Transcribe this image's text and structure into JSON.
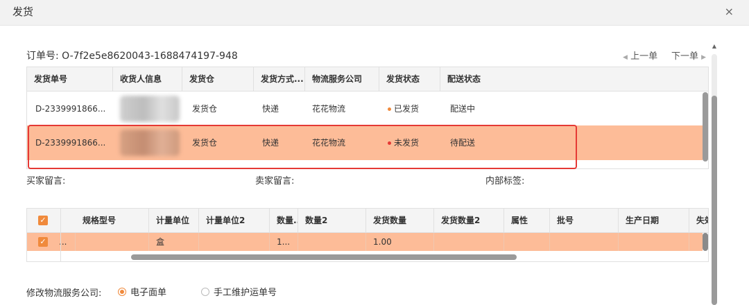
{
  "window": {
    "title": "发货",
    "close_glyph": "×"
  },
  "order": {
    "label": "订单号:",
    "number": "O-7f2e5e8620043-1688474197-948"
  },
  "nav": {
    "prev": "上一单",
    "next": "下一单"
  },
  "shipments": {
    "columns": [
      "发货单号",
      "收货人信息",
      "发货仓",
      "发货方式...",
      "物流服务公司",
      "发货状态",
      "配送状态"
    ],
    "rows": [
      {
        "id": "D-2339991866...",
        "consignee": "",
        "warehouse": "发货仓",
        "method": "快递",
        "carrier": "花花物流",
        "ship_status": "已发货",
        "ship_status_color": "#f08a3c",
        "delivery_status": "配送中"
      },
      {
        "id": "D-2339991866...",
        "consignee": "",
        "warehouse": "发货仓",
        "method": "快递",
        "carrier": "花花物流",
        "ship_status": "未发货",
        "ship_status_color": "#e53935",
        "delivery_status": "待配送"
      }
    ]
  },
  "messages": {
    "buyer": "买家留言:",
    "seller": "卖家留言:",
    "tag": "内部标签:"
  },
  "items": {
    "columns": [
      "规格型号",
      "计量单位",
      "计量单位2",
      "数量...",
      "数量2",
      "发货数量",
      "发货数量2",
      "属性",
      "批号",
      "生产日期",
      "失效"
    ],
    "row": {
      "first": "...",
      "spec": "",
      "unit": "盒",
      "unit2": "",
      "qty": "1...",
      "qty2": "",
      "ship_qty": "1.00",
      "ship_qty2": ""
    }
  },
  "logistics": {
    "label": "修改物流服务公司:",
    "option1": "电子面单",
    "option2": "手工维护运单号",
    "selected": "电子面单"
  },
  "colors": {
    "accent": "#f08a3c",
    "selected_row": "#fdbc98",
    "highlight_border": "#e53935"
  }
}
